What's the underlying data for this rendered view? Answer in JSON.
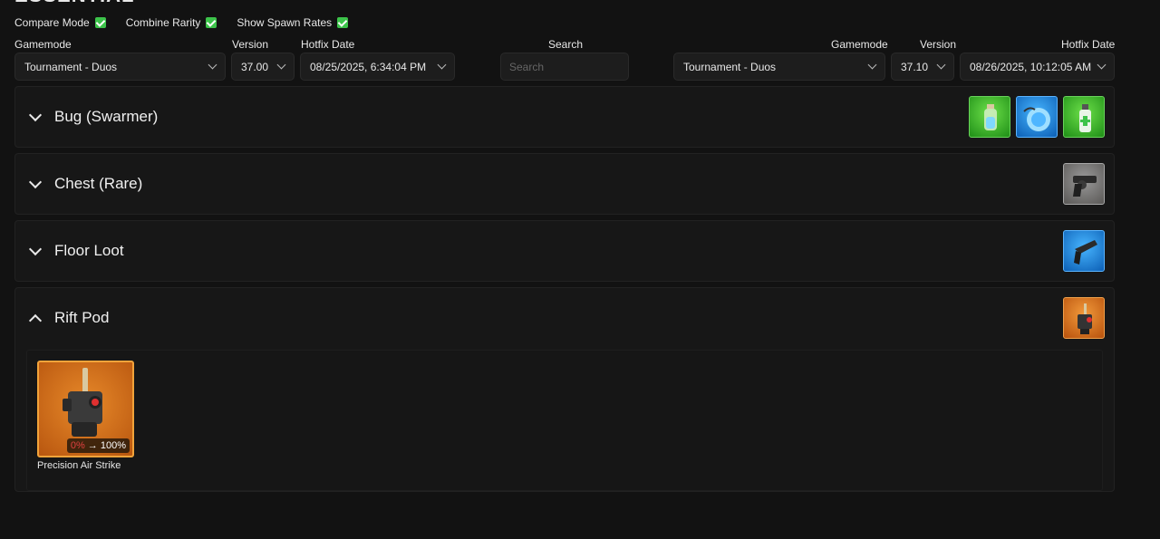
{
  "toggles": [
    {
      "label": "Compare Mode",
      "checked": true
    },
    {
      "label": "Combine Rarity",
      "checked": true
    },
    {
      "label": "Show Spawn Rates",
      "checked": true
    }
  ],
  "left": {
    "gamemode_label": "Gamemode",
    "gamemode": "Tournament - Duos",
    "version_label": "Version",
    "version": "37.00",
    "hotfix_label": "Hotfix Date",
    "hotfix": "08/25/2025, 6:34:04 PM"
  },
  "search": {
    "label": "Search",
    "placeholder": "Search"
  },
  "right": {
    "gamemode_label": "Gamemode",
    "gamemode": "Tournament - Duos",
    "version_label": "Version",
    "version": "37.10",
    "hotfix_label": "Hotfix Date",
    "hotfix": "08/26/2025, 10:12:05 AM"
  },
  "sections": [
    {
      "title": "Bug (Swarmer)",
      "expanded": false,
      "thumbs": [
        "bottle-icon",
        "bomb-icon",
        "spray-can-icon"
      ]
    },
    {
      "title": "Chest (Rare)",
      "expanded": false,
      "thumbs": [
        "revolver-icon"
      ]
    },
    {
      "title": "Floor Loot",
      "expanded": false,
      "thumbs": [
        "pistol-icon"
      ]
    },
    {
      "title": "Rift Pod",
      "expanded": true,
      "thumbs": [
        "airstrike-icon"
      ]
    }
  ],
  "rift_pod_item": {
    "name": "Precision Air Strike",
    "rate_old": "0%",
    "rate_arrow": "→",
    "rate_new": "100%"
  },
  "colors": {
    "uncommon": "#1f8f17",
    "rare": "#0c5fb5",
    "common": "#5a5856",
    "legendary": "#b8520d",
    "checkbox": "#3cc34a"
  }
}
